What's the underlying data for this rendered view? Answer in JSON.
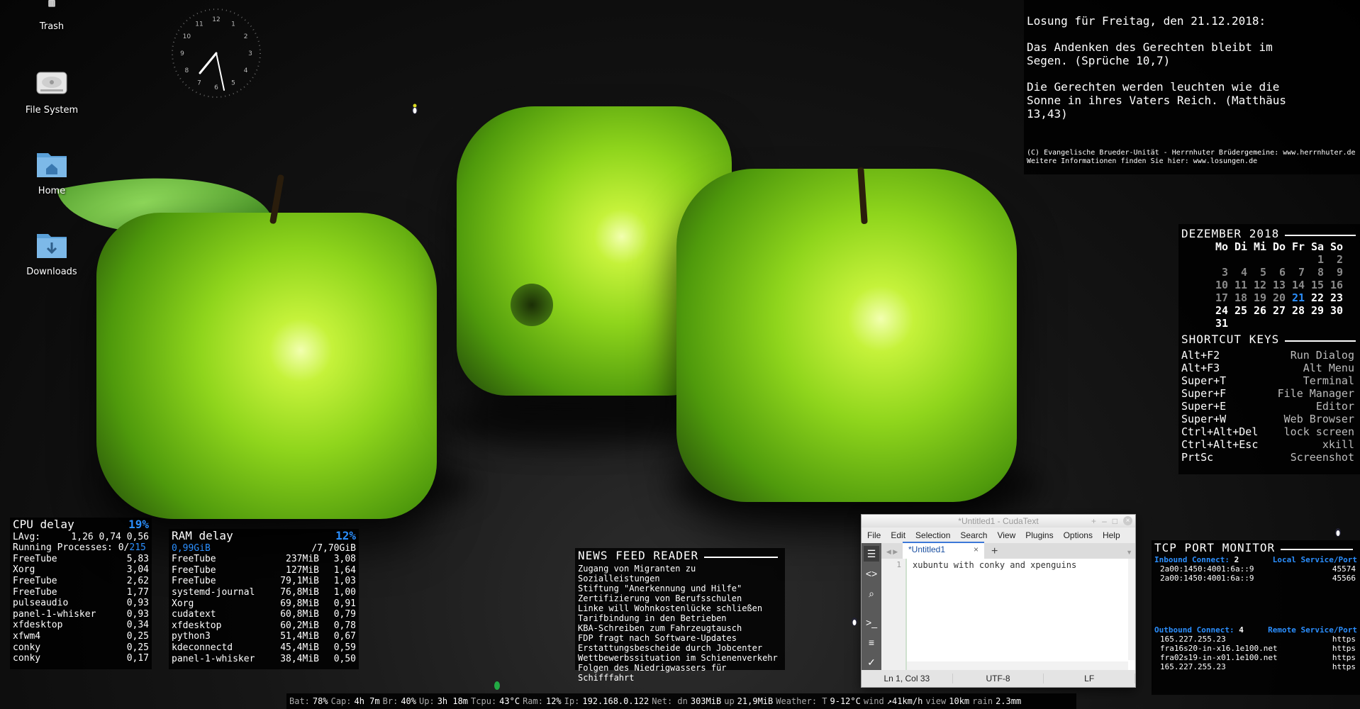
{
  "desktop_icons": [
    {
      "label": "Trash",
      "icon": "trash-icon"
    },
    {
      "label": "File System",
      "icon": "drive-icon"
    },
    {
      "label": "Home",
      "icon": "home-folder-icon"
    },
    {
      "label": "Downloads",
      "icon": "downloads-folder-icon"
    }
  ],
  "clock": {
    "numbers": [
      "12",
      "1",
      "2",
      "3",
      "4",
      "5",
      "6",
      "7",
      "8",
      "9",
      "10",
      "11"
    ]
  },
  "losung": {
    "heading": "Losung für Freitag, den 21.12.2018:",
    "verse1": "Das Andenken des Gerechten bleibt im\nSegen. (Sprüche 10,7)",
    "verse2": "Die Gerechten werden leuchten wie die\nSonne in ihres Vaters Reich. (Matthäus\n13,43)",
    "credit1": "(C) Evangelische Brueder-Unität - Herrnhuter Brüdergemeine: www.herrnhuter.de",
    "credit2": "Weitere Informationen finden Sie hier: www.losungen.de"
  },
  "calendar": {
    "title": "DEZEMBER 2018",
    "weekdays": [
      "Mo",
      "Di",
      "Mi",
      "Do",
      "Fr",
      "Sa",
      "So"
    ],
    "rows": [
      [
        "",
        "",
        "",
        "",
        "",
        "1",
        "2"
      ],
      [
        "3",
        "4",
        "5",
        "6",
        "7",
        "8",
        "9"
      ],
      [
        "10",
        "11",
        "12",
        "13",
        "14",
        "15",
        "16"
      ],
      [
        "17",
        "18",
        "19",
        "20",
        "21",
        "22",
        "23"
      ],
      [
        "24",
        "25",
        "26",
        "27",
        "28",
        "29",
        "30"
      ],
      [
        "31",
        "",
        "",
        "",
        "",
        "",
        ""
      ]
    ],
    "today": "21"
  },
  "shortcuts": {
    "title": "SHORTCUT KEYS",
    "items": [
      {
        "key": "Alt+F2",
        "desc": "Run Dialog"
      },
      {
        "key": "Alt+F3",
        "desc": "Alt Menu"
      },
      {
        "key": "Super+T",
        "desc": "Terminal"
      },
      {
        "key": "Super+F",
        "desc": "File Manager"
      },
      {
        "key": "Super+E",
        "desc": "Editor"
      },
      {
        "key": "Super+W",
        "desc": "Web Browser"
      },
      {
        "key": "Ctrl+Alt+Del",
        "desc": "lock screen"
      },
      {
        "key": "Ctrl+Alt+Esc",
        "desc": "xkill"
      },
      {
        "key": "PrtSc",
        "desc": "Screenshot"
      }
    ]
  },
  "cpu": {
    "title": "CPU delay",
    "pct": "19%",
    "lavg_label": "LAvg:",
    "lavg": "1,26 0,74 0,56",
    "running_label": "Running Processes:",
    "running": "0",
    "total": "215",
    "procs": [
      {
        "name": "FreeTube",
        "val": "5,83"
      },
      {
        "name": "Xorg",
        "val": "3,04"
      },
      {
        "name": "FreeTube",
        "val": "2,62"
      },
      {
        "name": "FreeTube",
        "val": "1,77"
      },
      {
        "name": "pulseaudio",
        "val": "0,93"
      },
      {
        "name": "panel-1-whisker",
        "val": "0,93"
      },
      {
        "name": "xfdesktop",
        "val": "0,34"
      },
      {
        "name": "xfwm4",
        "val": "0,25"
      },
      {
        "name": "conky",
        "val": "0,25"
      },
      {
        "name": "conky",
        "val": "0,17"
      }
    ]
  },
  "ram": {
    "title": "RAM delay",
    "pct": "12%",
    "used": "0,99GiB",
    "total": "/7,70GiB",
    "procs": [
      {
        "name": "FreeTube",
        "mem": "237MiB",
        "pct": "3,08"
      },
      {
        "name": "FreeTube",
        "mem": "127MiB",
        "pct": "1,64"
      },
      {
        "name": "FreeTube",
        "mem": "79,1MiB",
        "pct": "1,03"
      },
      {
        "name": "systemd-journal",
        "mem": "76,8MiB",
        "pct": "1,00"
      },
      {
        "name": "Xorg",
        "mem": "69,8MiB",
        "pct": "0,91"
      },
      {
        "name": "cudatext",
        "mem": "60,8MiB",
        "pct": "0,79"
      },
      {
        "name": "xfdesktop",
        "mem": "60,2MiB",
        "pct": "0,78"
      },
      {
        "name": "python3",
        "mem": "51,4MiB",
        "pct": "0,67"
      },
      {
        "name": "kdeconnectd",
        "mem": "45,4MiB",
        "pct": "0,59"
      },
      {
        "name": "panel-1-whisker",
        "mem": "38,4MiB",
        "pct": "0,50"
      }
    ]
  },
  "news": {
    "title": "NEWS FEED READER",
    "items": [
      "Zugang von Migranten zu Sozialleistungen",
      "Stiftung \"Anerkennung und Hilfe\"",
      "Zertifizierung von Berufsschulen",
      "Linke will Wohnkostenlücke schließen",
      "Tarifbindung in den Betrieben",
      "KBA-Schreiben zum Fahrzeugtausch",
      "FDP fragt nach Software-Updates",
      "Erstattungsbescheide durch Jobcenter",
      "Wettbewerbssituation im Schienenverkehr",
      "Folgen des Niedrigwassers für Schifffahrt"
    ]
  },
  "tcp": {
    "title": "TCP PORT MONITOR",
    "inbound_label": "Inbound Connect:",
    "inbound_count": "2",
    "local_label": "Local Service/Port",
    "inbound": [
      {
        "addr": "2a00:1450:4001:6a::9",
        "port": "45574"
      },
      {
        "addr": "2a00:1450:4001:6a::9",
        "port": "45566"
      }
    ],
    "outbound_label": "Outbound Connect:",
    "outbound_count": "4",
    "remote_label": "Remote Service/Port",
    "outbound": [
      {
        "addr": "165.227.255.23",
        "port": "https"
      },
      {
        "addr": "fra16s20-in-x16.1e100.net",
        "port": "https"
      },
      {
        "addr": "fra02s19-in-x01.1e100.net",
        "port": "https"
      },
      {
        "addr": "165.227.255.23",
        "port": "https"
      }
    ]
  },
  "statusbar": {
    "bat_l": "Bat:",
    "bat": "78%",
    "cap_l": "Cap:",
    "cap": "4h 7m",
    "br_l": "Br:",
    "br": "40%",
    "up_l": "Up:",
    "up": "3h 18m",
    "tcpu_l": "Tcpu:",
    "tcpu": "43°C",
    "ram_l": "Ram:",
    "ram": "12%",
    "ip_l": "Ip:",
    "ip": "192.168.0.122",
    "net_l": "Net: dn",
    "net_dn": "303MiB",
    "net_up_l": "up",
    "net_up": "21,9MiB",
    "weather_l": "Weather: T",
    "temp": "9-12°C",
    "wind_l": "wind",
    "wind": "↗41km/h",
    "view_l": "view",
    "view": "10km",
    "rain_l": "rain",
    "rain": "2.3mm"
  },
  "editor": {
    "title": "*Untitled1 - CudaText",
    "menu": [
      "File",
      "Edit",
      "Selection",
      "Search",
      "View",
      "Plugins",
      "Options",
      "Help"
    ],
    "tab": "*Untitled1",
    "tab_close": "×",
    "add_tab": "+",
    "line_no": "1",
    "code": "xubuntu with conky and xpenguins",
    "status": [
      "Ln 1, Col 33",
      "UTF-8",
      "LF"
    ]
  }
}
